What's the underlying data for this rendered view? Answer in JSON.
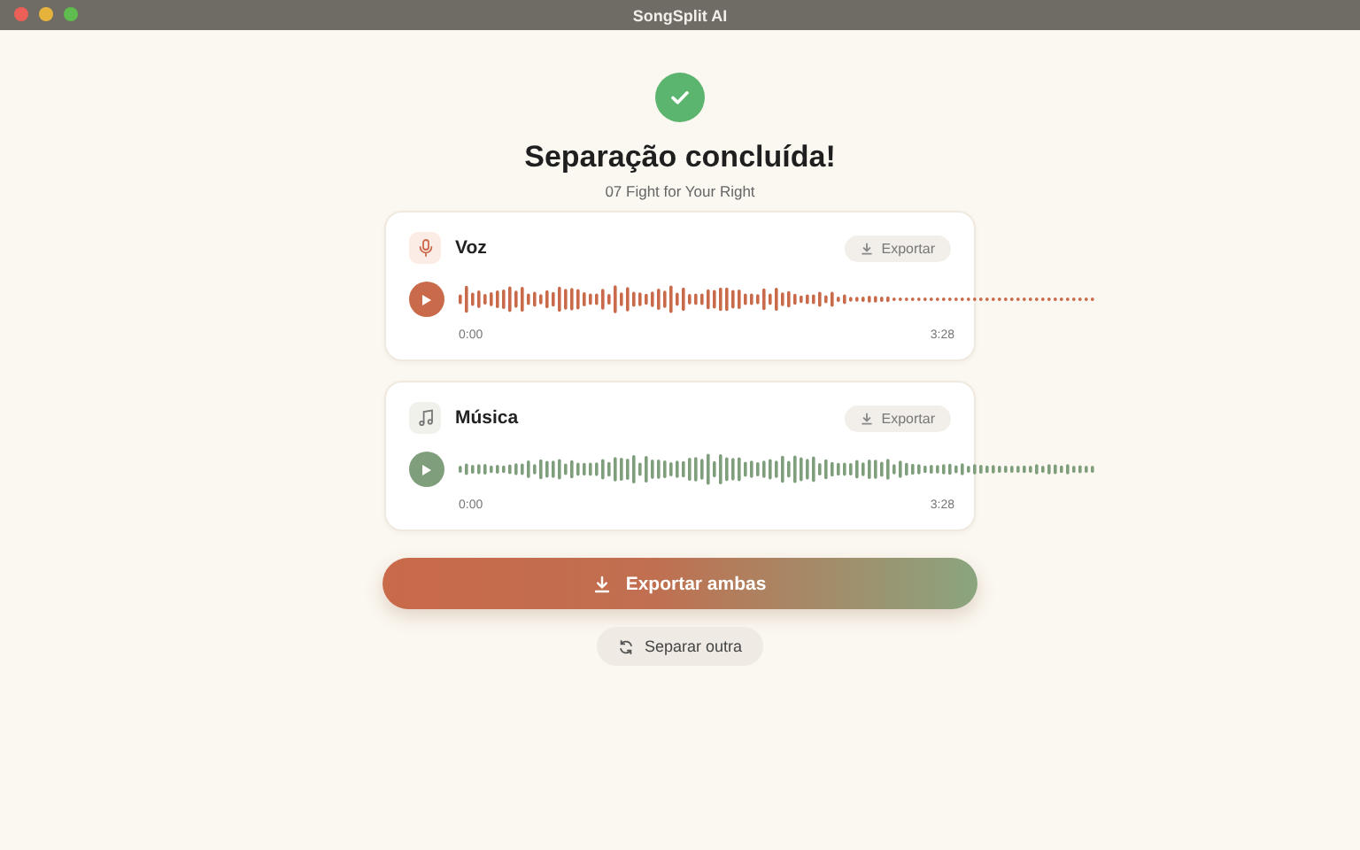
{
  "window": {
    "title": "SongSplit AI"
  },
  "header": {
    "title": "Separação concluída!",
    "subtitle": "07 Fight for Your Right"
  },
  "tracks": [
    {
      "kind": "voice",
      "name": "Voz",
      "color": "#c96a4a",
      "export_label": "Exportar",
      "start_time": "0:00",
      "end_time": "3:28"
    },
    {
      "kind": "music",
      "name": "Música",
      "color": "#7f9e7c",
      "export_label": "Exportar",
      "start_time": "0:00",
      "end_time": "3:28"
    }
  ],
  "export_all_label": "Exportar ambas",
  "again_label": "Separar outra"
}
